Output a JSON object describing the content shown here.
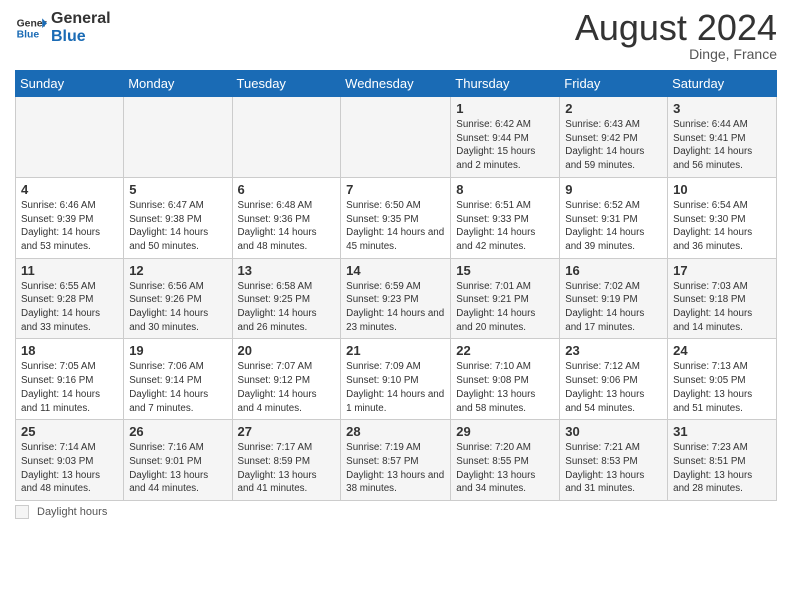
{
  "header": {
    "logo_line1": "General",
    "logo_line2": "Blue",
    "month_title": "August 2024",
    "location": "Dinge, France"
  },
  "footer": {
    "daylight_label": "Daylight hours"
  },
  "weekdays": [
    "Sunday",
    "Monday",
    "Tuesday",
    "Wednesday",
    "Thursday",
    "Friday",
    "Saturday"
  ],
  "weeks": [
    [
      {
        "day": "",
        "info": ""
      },
      {
        "day": "",
        "info": ""
      },
      {
        "day": "",
        "info": ""
      },
      {
        "day": "",
        "info": ""
      },
      {
        "day": "1",
        "info": "Sunrise: 6:42 AM\nSunset: 9:44 PM\nDaylight: 15 hours and 2 minutes."
      },
      {
        "day": "2",
        "info": "Sunrise: 6:43 AM\nSunset: 9:42 PM\nDaylight: 14 hours and 59 minutes."
      },
      {
        "day": "3",
        "info": "Sunrise: 6:44 AM\nSunset: 9:41 PM\nDaylight: 14 hours and 56 minutes."
      }
    ],
    [
      {
        "day": "4",
        "info": "Sunrise: 6:46 AM\nSunset: 9:39 PM\nDaylight: 14 hours and 53 minutes."
      },
      {
        "day": "5",
        "info": "Sunrise: 6:47 AM\nSunset: 9:38 PM\nDaylight: 14 hours and 50 minutes."
      },
      {
        "day": "6",
        "info": "Sunrise: 6:48 AM\nSunset: 9:36 PM\nDaylight: 14 hours and 48 minutes."
      },
      {
        "day": "7",
        "info": "Sunrise: 6:50 AM\nSunset: 9:35 PM\nDaylight: 14 hours and 45 minutes."
      },
      {
        "day": "8",
        "info": "Sunrise: 6:51 AM\nSunset: 9:33 PM\nDaylight: 14 hours and 42 minutes."
      },
      {
        "day": "9",
        "info": "Sunrise: 6:52 AM\nSunset: 9:31 PM\nDaylight: 14 hours and 39 minutes."
      },
      {
        "day": "10",
        "info": "Sunrise: 6:54 AM\nSunset: 9:30 PM\nDaylight: 14 hours and 36 minutes."
      }
    ],
    [
      {
        "day": "11",
        "info": "Sunrise: 6:55 AM\nSunset: 9:28 PM\nDaylight: 14 hours and 33 minutes."
      },
      {
        "day": "12",
        "info": "Sunrise: 6:56 AM\nSunset: 9:26 PM\nDaylight: 14 hours and 30 minutes."
      },
      {
        "day": "13",
        "info": "Sunrise: 6:58 AM\nSunset: 9:25 PM\nDaylight: 14 hours and 26 minutes."
      },
      {
        "day": "14",
        "info": "Sunrise: 6:59 AM\nSunset: 9:23 PM\nDaylight: 14 hours and 23 minutes."
      },
      {
        "day": "15",
        "info": "Sunrise: 7:01 AM\nSunset: 9:21 PM\nDaylight: 14 hours and 20 minutes."
      },
      {
        "day": "16",
        "info": "Sunrise: 7:02 AM\nSunset: 9:19 PM\nDaylight: 14 hours and 17 minutes."
      },
      {
        "day": "17",
        "info": "Sunrise: 7:03 AM\nSunset: 9:18 PM\nDaylight: 14 hours and 14 minutes."
      }
    ],
    [
      {
        "day": "18",
        "info": "Sunrise: 7:05 AM\nSunset: 9:16 PM\nDaylight: 14 hours and 11 minutes."
      },
      {
        "day": "19",
        "info": "Sunrise: 7:06 AM\nSunset: 9:14 PM\nDaylight: 14 hours and 7 minutes."
      },
      {
        "day": "20",
        "info": "Sunrise: 7:07 AM\nSunset: 9:12 PM\nDaylight: 14 hours and 4 minutes."
      },
      {
        "day": "21",
        "info": "Sunrise: 7:09 AM\nSunset: 9:10 PM\nDaylight: 14 hours and 1 minute."
      },
      {
        "day": "22",
        "info": "Sunrise: 7:10 AM\nSunset: 9:08 PM\nDaylight: 13 hours and 58 minutes."
      },
      {
        "day": "23",
        "info": "Sunrise: 7:12 AM\nSunset: 9:06 PM\nDaylight: 13 hours and 54 minutes."
      },
      {
        "day": "24",
        "info": "Sunrise: 7:13 AM\nSunset: 9:05 PM\nDaylight: 13 hours and 51 minutes."
      }
    ],
    [
      {
        "day": "25",
        "info": "Sunrise: 7:14 AM\nSunset: 9:03 PM\nDaylight: 13 hours and 48 minutes."
      },
      {
        "day": "26",
        "info": "Sunrise: 7:16 AM\nSunset: 9:01 PM\nDaylight: 13 hours and 44 minutes."
      },
      {
        "day": "27",
        "info": "Sunrise: 7:17 AM\nSunset: 8:59 PM\nDaylight: 13 hours and 41 minutes."
      },
      {
        "day": "28",
        "info": "Sunrise: 7:19 AM\nSunset: 8:57 PM\nDaylight: 13 hours and 38 minutes."
      },
      {
        "day": "29",
        "info": "Sunrise: 7:20 AM\nSunset: 8:55 PM\nDaylight: 13 hours and 34 minutes."
      },
      {
        "day": "30",
        "info": "Sunrise: 7:21 AM\nSunset: 8:53 PM\nDaylight: 13 hours and 31 minutes."
      },
      {
        "day": "31",
        "info": "Sunrise: 7:23 AM\nSunset: 8:51 PM\nDaylight: 13 hours and 28 minutes."
      }
    ]
  ]
}
